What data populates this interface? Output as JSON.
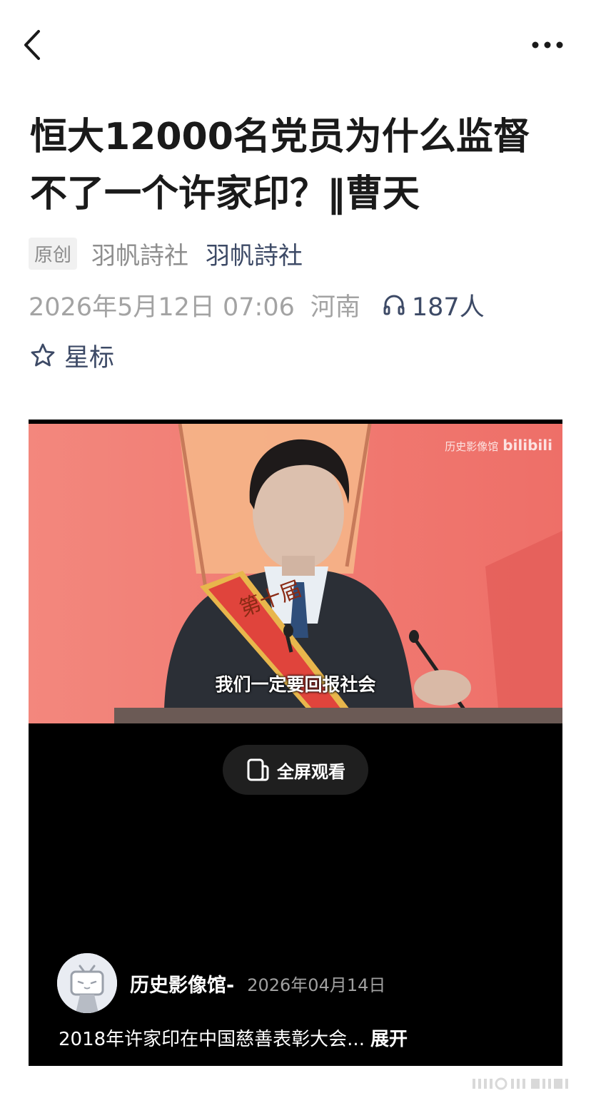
{
  "nav": {
    "back_icon": "chevron-left-icon",
    "more_icon": "more-horizontal-icon"
  },
  "article": {
    "title": "恒大12000名党员为什么监督不了一个许家印？‖曹天",
    "original_badge": "原创",
    "author_plain": "羽帆詩社",
    "author_link": "羽帆詩社",
    "date": "2026年5月12日 07:06",
    "location": "河南",
    "listen_icon": "headphones-icon",
    "listen_count": "187人",
    "star_icon": "star-outline-icon",
    "star_label": "星标"
  },
  "video": {
    "watermark": "历史影像馆",
    "bili_logo": "bilibili",
    "subtitle": "我们一定要回报社会",
    "fullscreen_label": "全屏观看",
    "fullscreen_icon": "fullscreen-phone-icon",
    "uploader_name": "历史影像馆-",
    "upload_date": "2026年04月14日",
    "caption": "2018年许家印在中国慈善表彰大会...",
    "expand_label": "展开"
  },
  "colors": {
    "link": "#3d4a66",
    "muted": "#a3a3a3",
    "video_bg": "#000000",
    "stage_red": "#f07a72"
  }
}
